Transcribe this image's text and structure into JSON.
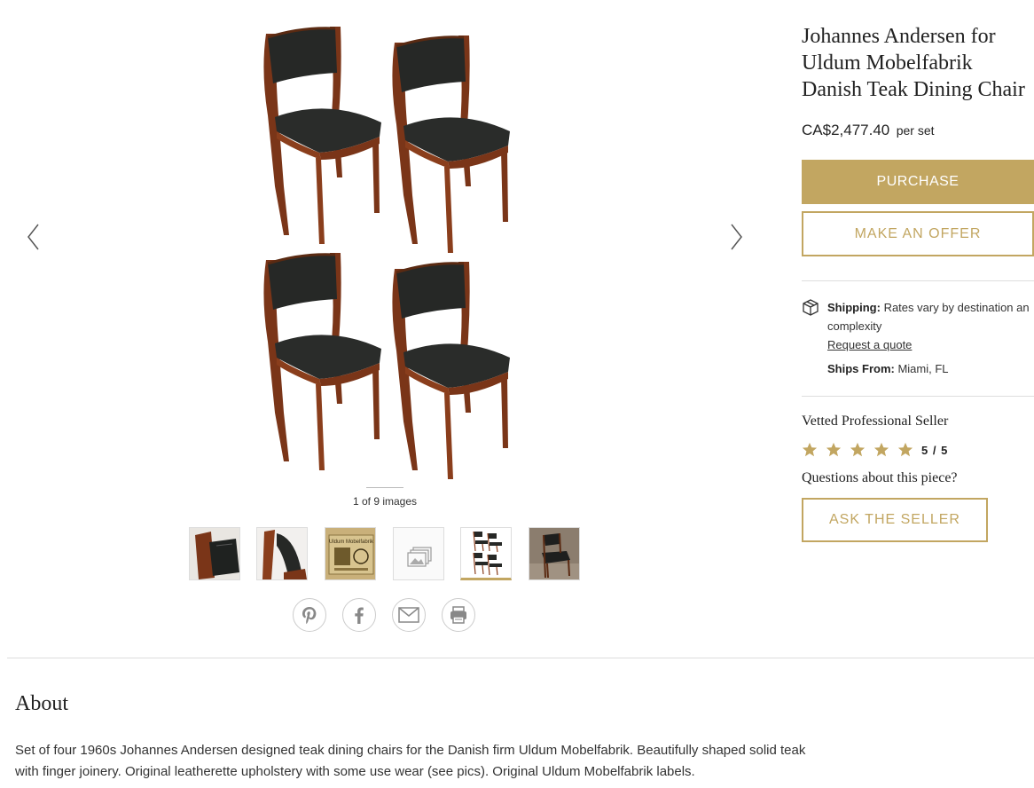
{
  "gallery": {
    "counter": "1 of 9 images",
    "thumbnails": [
      {
        "name": "chair-detail-1"
      },
      {
        "name": "chair-detail-2"
      },
      {
        "name": "label",
        "label_text": "Uldum Mobelfabrik"
      },
      {
        "name": "more-images-icon"
      },
      {
        "name": "four-chairs",
        "active": true
      },
      {
        "name": "single-chair"
      }
    ],
    "share_icons": [
      "pinterest-icon",
      "facebook-icon",
      "email-icon",
      "print-icon"
    ]
  },
  "product": {
    "title_lines": [
      "Johannes Andersen for",
      "Uldum Mobelfabrik",
      "Danish Teak Dining Chair"
    ],
    "price": "CA$2,477.40",
    "price_unit": "per set",
    "purchase_label": "PURCHASE",
    "offer_label": "MAKE AN OFFER"
  },
  "shipping": {
    "label": "Shipping:",
    "text_line1": "Rates vary by destination an",
    "text_line2": "complexity",
    "quote_link": "Request a quote",
    "ships_from_label": "Ships From:",
    "ships_from_value": "Miami, FL"
  },
  "seller": {
    "vetted": "Vetted Professional Seller",
    "rating": "5 / 5",
    "star_count": 5,
    "questions": "Questions about this piece?",
    "ask_label": "ASK THE SELLER"
  },
  "about": {
    "heading": "About",
    "line1": "Set of four 1960s Johannes Andersen designed teak dining chairs for the Danish firm Uldum Mobelfabrik. Beautifully shaped solid teak",
    "line2": "with finger joinery. Original leatherette upholstery with some use wear (see pics). Original Uldum Mobelfabrik labels."
  },
  "colors": {
    "accent": "#c2a661",
    "teak": "#8a3e1c",
    "upholstery": "#262826"
  }
}
